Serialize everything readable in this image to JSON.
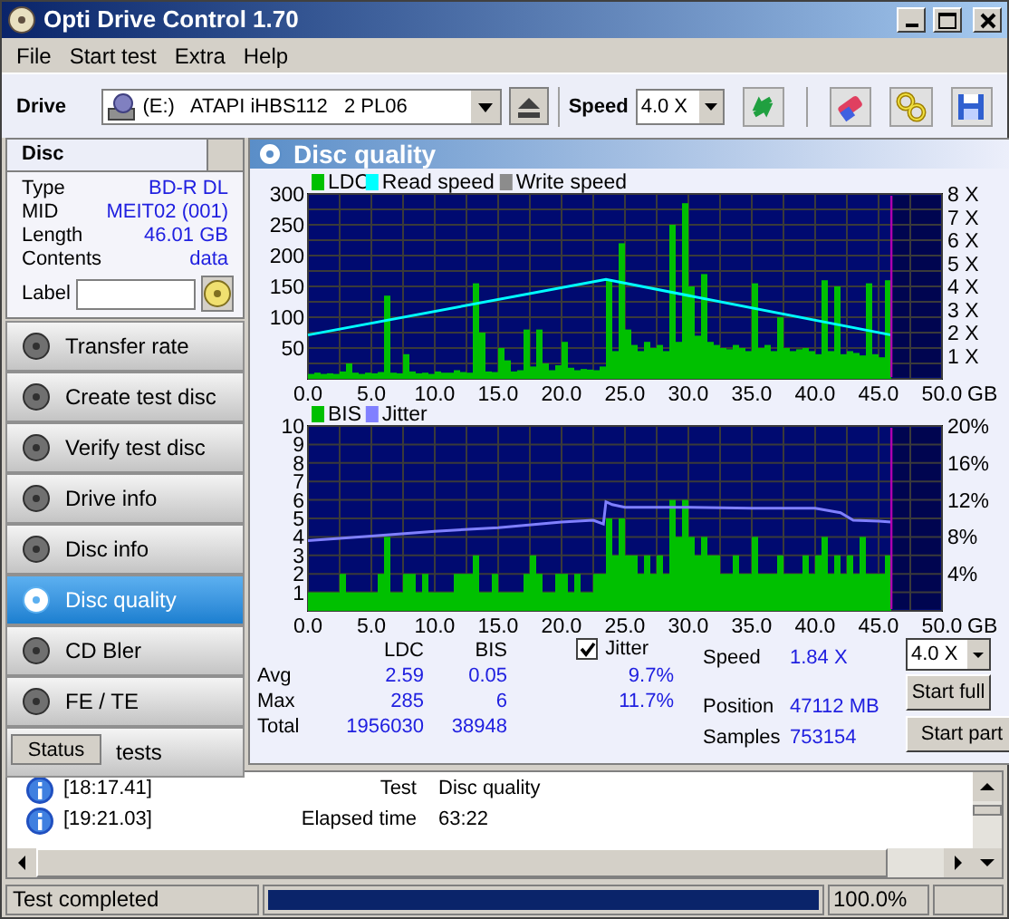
{
  "window": {
    "title": "Opti Drive Control 1.70"
  },
  "menu": [
    "File",
    "Start test",
    "Extra",
    "Help"
  ],
  "toolbar": {
    "drive_label": "Drive",
    "drive": "(E:)   ATAPI iHBS112   2 PL06",
    "speed_label": "Speed",
    "speed": "4.0 X"
  },
  "disc": {
    "title": "Disc",
    "fields": [
      {
        "label": "Type",
        "value": "BD-R DL"
      },
      {
        "label": "MID",
        "value": "MEIT02 (001)"
      },
      {
        "label": "Length",
        "value": "46.01 GB"
      },
      {
        "label": "Contents",
        "value": "data"
      }
    ],
    "label_field": "Label"
  },
  "nav": [
    {
      "label": "Transfer rate",
      "selected": false
    },
    {
      "label": "Create test disc",
      "selected": false
    },
    {
      "label": "Verify test disc",
      "selected": false
    },
    {
      "label": "Drive info",
      "selected": false
    },
    {
      "label": "Disc info",
      "selected": false
    },
    {
      "label": "Disc quality",
      "selected": true
    },
    {
      "label": "CD Bler",
      "selected": false
    },
    {
      "label": "FE / TE",
      "selected": false
    },
    {
      "label": "tests",
      "selected": false
    }
  ],
  "status_tab": "Status",
  "panel": {
    "title": "Disc quality",
    "charts": [
      {
        "chart_data": {
          "type": "bar",
          "xlabel": "GB",
          "xlim": [
            0,
            50
          ],
          "ylim": [
            0,
            300
          ],
          "xticks": [
            {
              "value": 0,
              "label": "0.0"
            },
            {
              "value": 5,
              "label": "5.0"
            },
            {
              "value": 10,
              "label": "10.0"
            },
            {
              "value": 15,
              "label": "15.0"
            },
            {
              "value": 20,
              "label": "20.0"
            },
            {
              "value": 25,
              "label": "25.0"
            },
            {
              "value": 30,
              "label": "30.0"
            },
            {
              "value": 35,
              "label": "35.0"
            },
            {
              "value": 40,
              "label": "40.0"
            },
            {
              "value": 45,
              "label": "45.0"
            },
            {
              "value": 50,
              "label": "50.0"
            }
          ],
          "yticks": [
            50,
            100,
            150,
            200,
            250,
            300
          ],
          "y2ticks": [
            {
              "value": 1,
              "label": "1 X"
            },
            {
              "value": 2,
              "label": "2 X"
            },
            {
              "value": 3,
              "label": "3 X"
            },
            {
              "value": 4,
              "label": "4 X"
            },
            {
              "value": 5,
              "label": "5 X"
            },
            {
              "value": 6,
              "label": "6 X"
            },
            {
              "value": 7,
              "label": "7 X"
            },
            {
              "value": 8,
              "label": "8 X"
            }
          ],
          "y2lim": [
            0,
            8
          ],
          "series": [
            {
              "name": "LDC",
              "color": "#00c000",
              "x": [
                0.25,
                0.75,
                1.25,
                1.75,
                2.25,
                2.75,
                3.25,
                3.75,
                4.25,
                4.75,
                5.25,
                5.75,
                6.25,
                6.75,
                7.25,
                7.75,
                8.25,
                8.75,
                9.25,
                9.75,
                10.25,
                10.75,
                11.25,
                11.75,
                12.25,
                12.75,
                13.25,
                13.75,
                14.25,
                14.75,
                15.25,
                15.75,
                16.25,
                16.75,
                17.25,
                17.75,
                18.25,
                18.75,
                19.25,
                19.75,
                20.25,
                20.75,
                21.25,
                21.75,
                22.25,
                22.75,
                23.25,
                23.75,
                24.25,
                24.75,
                25.25,
                25.75,
                26.25,
                26.75,
                27.25,
                27.75,
                28.25,
                28.75,
                29.25,
                29.75,
                30.25,
                30.75,
                31.25,
                31.75,
                32.25,
                32.75,
                33.25,
                33.75,
                34.25,
                34.75,
                35.25,
                35.75,
                36.25,
                36.75,
                37.25,
                37.75,
                38.25,
                38.75,
                39.25,
                39.75,
                40.25,
                40.75,
                41.25,
                41.75,
                42.25,
                42.75,
                43.25,
                43.75,
                44.25,
                44.75,
                45.25,
                45.75
              ],
              "values": [
                8,
                10,
                8,
                9,
                8,
                12,
                25,
                10,
                8,
                10,
                9,
                11,
                135,
                10,
                9,
                40,
                12,
                9,
                10,
                8,
                12,
                10,
                10,
                14,
                11,
                10,
                155,
                75,
                12,
                11,
                50,
                30,
                12,
                14,
                80,
                20,
                80,
                25,
                14,
                22,
                60,
                18,
                14,
                16,
                15,
                14,
                20,
                160,
                45,
                220,
                80,
                55,
                45,
                60,
                50,
                55,
                45,
                250,
                60,
                285,
                150,
                70,
                170,
                60,
                55,
                50,
                48,
                55,
                50,
                45,
                155,
                50,
                55,
                45,
                100,
                50,
                45,
                48,
                50,
                45,
                40,
                160,
                45,
                150,
                40,
                45,
                42,
                38,
                155,
                40,
                35,
                160
              ]
            },
            {
              "name": "Read speed",
              "color": "#00ffff",
              "type": "line",
              "axis": "y2",
              "x": [
                0,
                23.5,
                46
              ],
              "values": [
                1.9,
                4.3,
                1.9
              ]
            },
            {
              "name": "Write speed",
              "color": "#8c8c8c"
            }
          ],
          "ref_lines": [
            {
              "axis": "x",
              "value": 46.01,
              "color": "#b000b0"
            }
          ],
          "bands": [
            {
              "axis": "x",
              "from": 46.01,
              "to": 50,
              "color": "#000550"
            }
          ],
          "legend": "top left",
          "grid": true
        }
      },
      {
        "chart_data": {
          "type": "bar",
          "xlabel": "GB",
          "xlim": [
            0,
            50
          ],
          "ylim": [
            0,
            10
          ],
          "xticks": [
            {
              "value": 0,
              "label": "0.0"
            },
            {
              "value": 5,
              "label": "5.0"
            },
            {
              "value": 10,
              "label": "10.0"
            },
            {
              "value": 15,
              "label": "15.0"
            },
            {
              "value": 20,
              "label": "20.0"
            },
            {
              "value": 25,
              "label": "25.0"
            },
            {
              "value": 30,
              "label": "30.0"
            },
            {
              "value": 35,
              "label": "35.0"
            },
            {
              "value": 40,
              "label": "40.0"
            },
            {
              "value": 45,
              "label": "45.0"
            },
            {
              "value": 50,
              "label": "50.0"
            }
          ],
          "yticks": [
            1,
            2,
            3,
            4,
            5,
            6,
            7,
            8,
            9,
            10
          ],
          "y2ticks": [
            {
              "value": 4,
              "label": "4%"
            },
            {
              "value": 8,
              "label": "8%"
            },
            {
              "value": 12,
              "label": "12%"
            },
            {
              "value": 16,
              "label": "16%"
            },
            {
              "value": 20,
              "label": "20%"
            }
          ],
          "y2lim": [
            0,
            20
          ],
          "series": [
            {
              "name": "BIS",
              "color": "#00c000",
              "x": [
                0.25,
                0.75,
                1.25,
                1.75,
                2.25,
                2.75,
                3.25,
                3.75,
                4.25,
                4.75,
                5.25,
                5.75,
                6.25,
                6.75,
                7.25,
                7.75,
                8.25,
                8.75,
                9.25,
                9.75,
                10.25,
                10.75,
                11.25,
                11.75,
                12.25,
                12.75,
                13.25,
                13.75,
                14.25,
                14.75,
                15.25,
                15.75,
                16.25,
                16.75,
                17.25,
                17.75,
                18.25,
                18.75,
                19.25,
                19.75,
                20.25,
                20.75,
                21.25,
                21.75,
                22.25,
                22.75,
                23.25,
                23.75,
                24.25,
                24.75,
                25.25,
                25.75,
                26.25,
                26.75,
                27.25,
                27.75,
                28.25,
                28.75,
                29.25,
                29.75,
                30.25,
                30.75,
                31.25,
                31.75,
                32.25,
                32.75,
                33.25,
                33.75,
                34.25,
                34.75,
                35.25,
                35.75,
                36.25,
                36.75,
                37.25,
                37.75,
                38.25,
                38.75,
                39.25,
                39.75,
                40.25,
                40.75,
                41.25,
                41.75,
                42.25,
                42.75,
                43.25,
                43.75,
                44.25,
                44.75,
                45.25,
                45.75
              ],
              "values": [
                1,
                1,
                1,
                1,
                1,
                2,
                1,
                1,
                1,
                1,
                1,
                2,
                4,
                1,
                1,
                2,
                2,
                1,
                2,
                1,
                1,
                1,
                1,
                2,
                2,
                2,
                3,
                1,
                1,
                2,
                1,
                1,
                1,
                1,
                2,
                3,
                2,
                1,
                1,
                2,
                2,
                1,
                2,
                1,
                1,
                2,
                2,
                5,
                3,
                5,
                3,
                3,
                2,
                3,
                2,
                3,
                2,
                6,
                4,
                6,
                4,
                3,
                4,
                3,
                3,
                2,
                2,
                3,
                2,
                2,
                4,
                2,
                2,
                2,
                3,
                2,
                2,
                2,
                3,
                2,
                3,
                4,
                2,
                3,
                2,
                3,
                2,
                4,
                2,
                2,
                2,
                3
              ]
            },
            {
              "name": "Jitter",
              "color": "#8080ff",
              "type": "line",
              "axis": "y2",
              "x": [
                0,
                5,
                10,
                15,
                20,
                22.5,
                23.3,
                23.5,
                24,
                25,
                30,
                35,
                40,
                42,
                43,
                45,
                46
              ],
              "values": [
                7.6,
                8.1,
                8.6,
                9.0,
                9.6,
                9.8,
                9.4,
                11.8,
                11.5,
                11.2,
                11.2,
                11.1,
                11.1,
                10.6,
                9.8,
                9.7,
                9.6
              ]
            }
          ],
          "ref_lines": [
            {
              "axis": "x",
              "value": 46.01,
              "color": "#b000b0"
            }
          ],
          "bands": [
            {
              "axis": "x",
              "from": 46.01,
              "to": 50,
              "color": "#000550"
            }
          ],
          "legend": "top left",
          "grid": true
        }
      }
    ]
  },
  "stats": {
    "columns": [
      "LDC",
      "BIS"
    ],
    "rows": [
      {
        "label": "Avg",
        "ldc": "2.59",
        "bis": "0.05",
        "jitter": "9.7%"
      },
      {
        "label": "Max",
        "ldc": "285",
        "bis": "6",
        "jitter": "11.7%"
      },
      {
        "label": "Total",
        "ldc": "1956030",
        "bis": "38948"
      }
    ],
    "jitter": {
      "label": "Jitter",
      "checked": true
    },
    "info": [
      {
        "label": "Speed",
        "value": "1.84 X"
      },
      {
        "label": "Position",
        "value": "47112 MB"
      },
      {
        "label": "Samples",
        "value": "753154"
      }
    ],
    "speed_select": "4.0 X",
    "buttons": [
      "Start full",
      "Start part"
    ]
  },
  "log": [
    {
      "time": "[18:17.41]",
      "field": "Test",
      "value": "Disc quality"
    },
    {
      "time": "[19:21.03]",
      "field": "Elapsed time",
      "value": "63:22"
    }
  ],
  "status_bar": {
    "text": "Test completed",
    "progress": {
      "level": 1
    },
    "percent": "100.0%"
  }
}
